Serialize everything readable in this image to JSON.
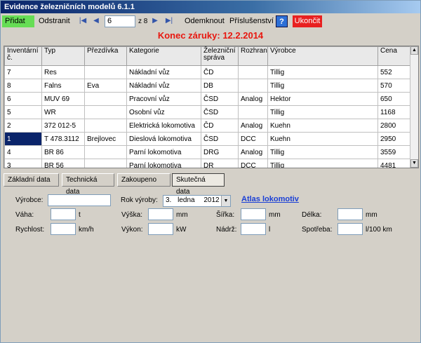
{
  "window": {
    "title": "Evidence železničních modelů 6.1.1"
  },
  "toolbar": {
    "add_label": "Přidat",
    "remove_label": "Odstranit",
    "first_icon": "first-record-icon",
    "prev_icon": "previous-record-icon",
    "next_icon": "next-record-icon",
    "last_icon": "last-record-icon",
    "record_value": "6",
    "record_total": "z 8",
    "unlock_label": "Odemknout",
    "accessories_label": "Příslušenství",
    "help_label": "?",
    "quit_label": "Ukončit"
  },
  "warranty": {
    "text": "Konec záruky:   12.2.2014"
  },
  "grid": {
    "columns": [
      "Inventární č.",
      "Typ",
      "Přezdívka",
      "Kategorie",
      "Železniční správa",
      "Rozhran",
      "Výrobce",
      "Cena"
    ],
    "rows": [
      [
        "7",
        "Res",
        "",
        "Nákladní vůz",
        "ČD",
        "",
        "Tillig",
        "552"
      ],
      [
        "8",
        "Falns",
        "Eva",
        "Nákladní vůz",
        "DB",
        "",
        "Tillig",
        "570"
      ],
      [
        "6",
        "MUV 69",
        "",
        "Pracovní vůz",
        "ČSD",
        "Analog",
        "Hektor",
        "650"
      ],
      [
        "5",
        "WR",
        "",
        "Osobní vůz",
        "ČSD",
        "",
        "Tillig",
        "1168"
      ],
      [
        "2",
        "372 012-5",
        "",
        "Elektrická lokomotiva",
        "ČD",
        "Analog",
        "Kuehn",
        "2800"
      ],
      [
        "1",
        "T 478.3112",
        "Brejlovec",
        "Dieslová lokomotiva",
        "ČSD",
        "DCC",
        "Kuehn",
        "2950"
      ],
      [
        "4",
        "BR 86",
        "",
        "Parní lokomotiva",
        "DRG",
        "Analog",
        "Tillig",
        "3559"
      ],
      [
        "3",
        "BR 56",
        "",
        "Parní lokomotiva",
        "DR",
        "DCC",
        "Tillig",
        "4481"
      ]
    ]
  },
  "tabs": [
    "Základní data",
    "Technická data",
    "Zakoupeno",
    "Skutečná data"
  ],
  "form": {
    "manufacturer_label": "Výrobce:",
    "manufacturer_value": "",
    "year_label": "Rok výroby:",
    "date_day": "3.",
    "date_month": "ledna",
    "date_year": "2012",
    "atlas_link": "Atlas lokomotiv",
    "weight_label": "Váha:",
    "weight_unit": "t",
    "height_label": "Výška:",
    "height_unit": "mm",
    "width_label": "Šířka:",
    "width_unit": "mm",
    "length_label": "Délka:",
    "length_unit": "mm",
    "speed_label": "Rychlost:",
    "speed_unit": "km/h",
    "power_label": "Výkon:",
    "power_unit": "kW",
    "tank_label": "Nádrž:",
    "tank_unit": "l",
    "consumption_label": "Spotřeba:",
    "consumption_unit": "l/100 km"
  }
}
